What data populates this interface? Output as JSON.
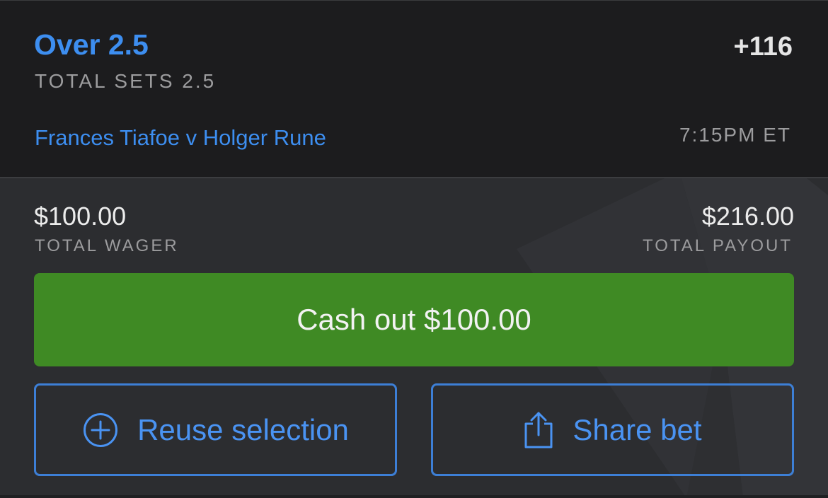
{
  "selection": {
    "title": "Over 2.5",
    "odds": "+116",
    "market": "TOTAL SETS 2.5",
    "event": "Frances Tiafoe v Holger Rune",
    "time": "7:15PM ET"
  },
  "summary": {
    "wager_amount": "$100.00",
    "wager_label": "TOTAL WAGER",
    "payout_amount": "$216.00",
    "payout_label": "TOTAL PAYOUT"
  },
  "actions": {
    "cashout_label": "Cash out $100.00",
    "reuse_label": "Reuse selection",
    "reuse_icon": "plus-circle-icon",
    "share_label": "Share bet",
    "share_icon": "share-icon"
  },
  "colors": {
    "accent_blue": "#3d8ef0",
    "cashout_green": "#3f8a24",
    "header_bg": "#1c1c1e",
    "body_bg": "#2c2d30"
  }
}
